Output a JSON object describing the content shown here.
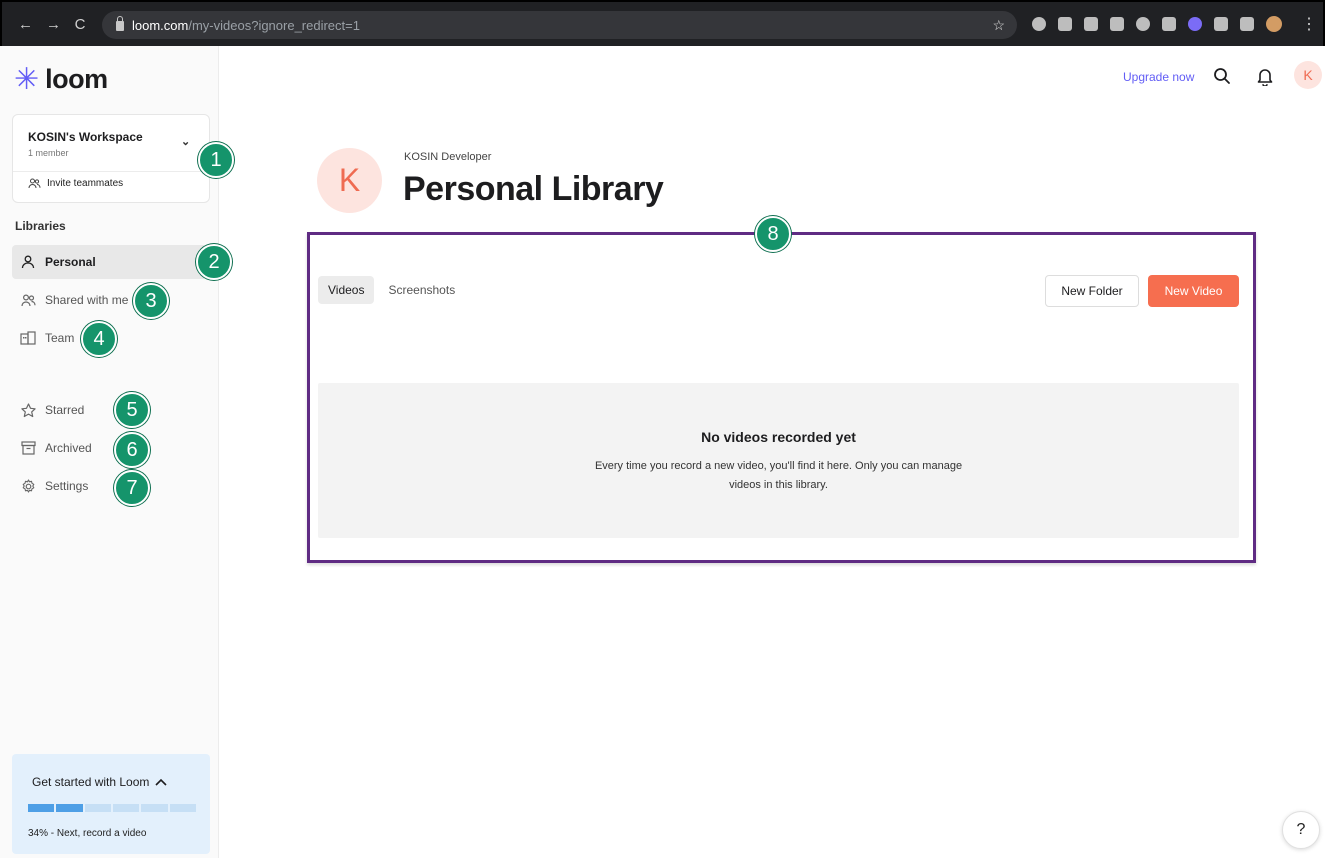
{
  "browser": {
    "url_domain": "loom.com",
    "url_path": "/my-videos?ignore_redirect=1"
  },
  "sidebar": {
    "logo_text": "loom",
    "workspace": {
      "name": "KOSIN's Workspace",
      "members": "1 member",
      "invite_label": "Invite teammates"
    },
    "libraries_label": "Libraries",
    "items": [
      {
        "label": "Personal",
        "icon": "person-icon",
        "active": true
      },
      {
        "label": "Shared with me",
        "icon": "people-icon",
        "active": false
      },
      {
        "label": "Team",
        "icon": "building-icon",
        "active": false
      },
      {
        "label": "Starred",
        "icon": "star-icon",
        "active": false
      },
      {
        "label": "Archived",
        "icon": "archive-icon",
        "active": false
      },
      {
        "label": "Settings",
        "icon": "gear-icon",
        "active": false
      }
    ],
    "get_started": {
      "title": "Get started with Loom",
      "progress_percent": 34,
      "status": "34% - Next, record a video"
    }
  },
  "header": {
    "upgrade_label": "Upgrade now",
    "avatar_initial": "K"
  },
  "library": {
    "owner": "KOSIN Developer",
    "title": "Personal Library",
    "avatar_initial": "K",
    "tabs": [
      {
        "label": "Videos",
        "active": true
      },
      {
        "label": "Screenshots",
        "active": false
      }
    ],
    "new_folder_label": "New Folder",
    "new_video_label": "New Video",
    "empty_title": "No videos recorded yet",
    "empty_desc": "Every time you record a new video, you'll find it here. Only you can manage videos in this library."
  },
  "callouts": [
    "1",
    "2",
    "3",
    "4",
    "5",
    "6",
    "7",
    "8"
  ],
  "help_label": "?",
  "colors": {
    "brand": "#625df5",
    "accent_button": "#f66e4f",
    "callout": "#15946b",
    "highlight_border": "#5f2b83",
    "avatar_bg": "#fde4df",
    "progress_fill": "#4e9fe6"
  }
}
